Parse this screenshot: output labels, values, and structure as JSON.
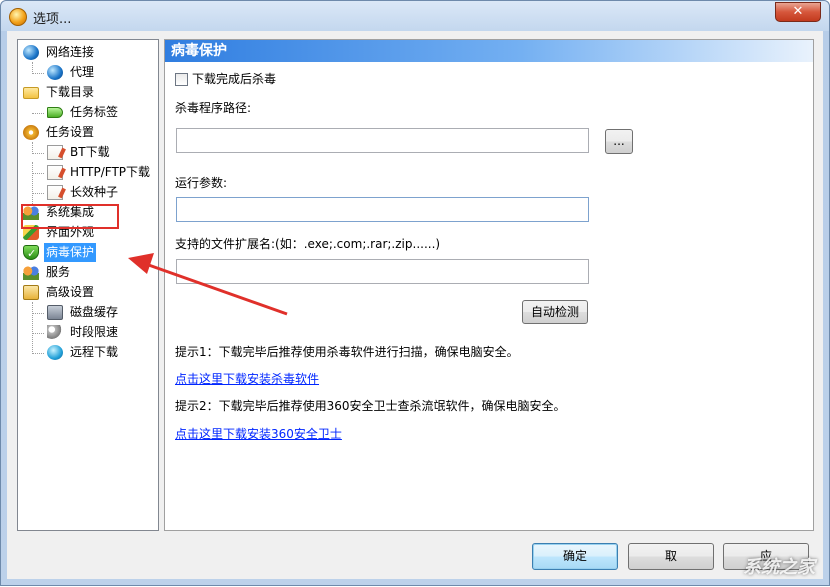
{
  "window": {
    "title": "选项...",
    "close_label": "✕"
  },
  "tree": [
    {
      "label": "网络连接",
      "icon": "globe-icon",
      "level": 0
    },
    {
      "label": "代理",
      "icon": "globe-icon",
      "level": 1
    },
    {
      "label": "下载目录",
      "icon": "folder-icon",
      "level": 0
    },
    {
      "label": "任务标签",
      "icon": "tag-icon",
      "level": 1
    },
    {
      "label": "任务设置",
      "icon": "gears-icon",
      "level": 0
    },
    {
      "label": "BT下载",
      "icon": "note-icon",
      "level": 1
    },
    {
      "label": "HTTP/FTP下载",
      "icon": "note-icon",
      "level": 1
    },
    {
      "label": "长效种子",
      "icon": "note-icon",
      "level": 1
    },
    {
      "label": "系统集成",
      "icon": "people-icon",
      "level": 0
    },
    {
      "label": "界面外观",
      "icon": "brush-icon",
      "level": 0
    },
    {
      "label": "病毒保护",
      "icon": "shield-icon",
      "level": 0,
      "selected": true
    },
    {
      "label": "服务",
      "icon": "people-icon",
      "level": 0
    },
    {
      "label": "高级设置",
      "icon": "advanced-icon",
      "level": 0
    },
    {
      "label": "磁盘缓存",
      "icon": "disk-icon",
      "level": 1
    },
    {
      "label": "时段限速",
      "icon": "key-icon",
      "level": 1
    },
    {
      "label": "远程下载",
      "icon": "remote-icon",
      "level": 1
    }
  ],
  "panel": {
    "title": "病毒保护",
    "scan_after_download": {
      "label": "下载完成后杀毒",
      "checked": false
    },
    "antivirus_path": {
      "label": "杀毒程序路径:",
      "value": "",
      "browse_label": "..."
    },
    "run_params": {
      "label": "运行参数:",
      "value": ""
    },
    "extensions": {
      "label": "支持的文件扩展名:(如：.exe;.com;.rar;.zip......)",
      "value": ""
    },
    "auto_detect_label": "自动检测",
    "tip1": "提示1：下载完毕后推荐使用杀毒软件进行扫描，确保电脑安全。",
    "link1": "点击这里下载安装杀毒软件",
    "tip2": "提示2：下载完毕后推荐使用360安全卫士查杀流氓软件，确保电脑安全。",
    "link2": "点击这里下载安装360安全卫士"
  },
  "footer": {
    "ok_label": "确定",
    "cancel_label": "取",
    "apply_label": "应"
  },
  "watermark": "系统之家",
  "colors": {
    "accent": "#3399ff",
    "annotation": "#e0302a",
    "link": "#0026ff"
  }
}
